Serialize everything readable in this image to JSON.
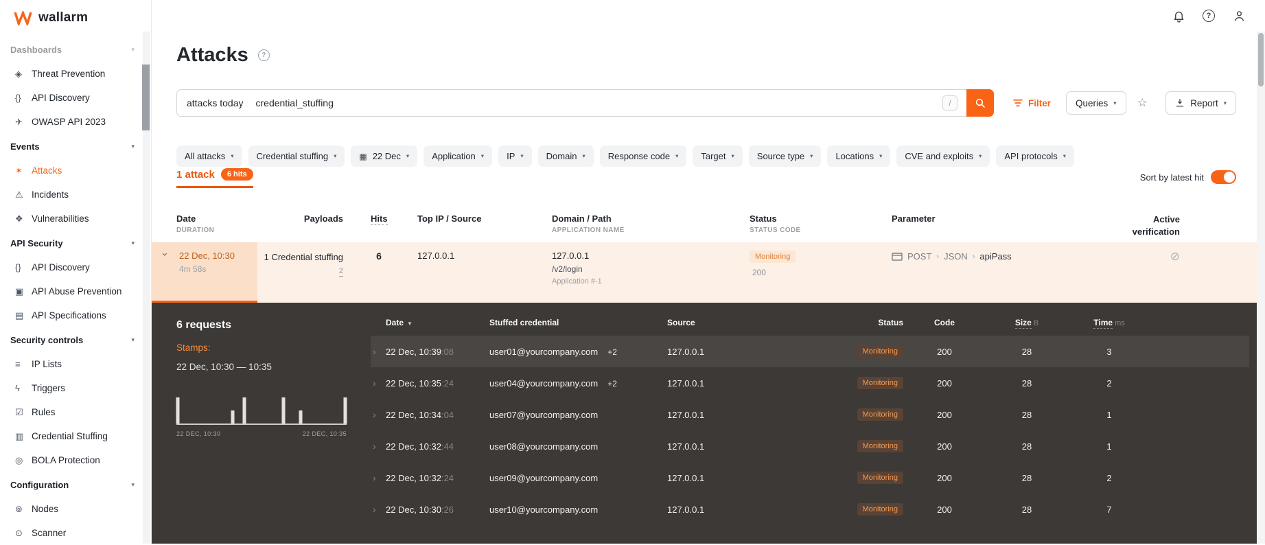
{
  "brand": {
    "name": "wallarm"
  },
  "topbar": {
    "icons": [
      "notifications-bell-icon",
      "help-icon",
      "user-icon"
    ]
  },
  "sidebar": {
    "items": [
      {
        "header": true,
        "label": "Dashboards",
        "faded": true
      },
      {
        "label": "Threat Prevention",
        "icon": "shield-check-icon"
      },
      {
        "label": "API Discovery",
        "icon": "code-braces-icon"
      },
      {
        "label": "OWASP API 2023",
        "icon": "paper-plane-icon"
      },
      {
        "header": true,
        "label": "Events"
      },
      {
        "label": "Attacks",
        "icon": "attack-burst-icon",
        "active": true
      },
      {
        "label": "Incidents",
        "icon": "warning-triangle-icon"
      },
      {
        "label": "Vulnerabilities",
        "icon": "vulnerability-icon"
      },
      {
        "header": true,
        "label": "API Security"
      },
      {
        "label": "API Discovery",
        "icon": "code-braces-icon"
      },
      {
        "label": "API Abuse Prevention",
        "icon": "bot-icon"
      },
      {
        "label": "API Specifications",
        "icon": "document-icon"
      },
      {
        "header": true,
        "label": "Security controls"
      },
      {
        "label": "IP Lists",
        "icon": "list-icon"
      },
      {
        "label": "Triggers",
        "icon": "lightning-icon"
      },
      {
        "label": "Rules",
        "icon": "checklist-icon"
      },
      {
        "label": "Credential Stuffing",
        "icon": "id-card-icon"
      },
      {
        "label": "BOLA Protection",
        "icon": "target-icon"
      },
      {
        "header": true,
        "label": "Configuration"
      },
      {
        "label": "Nodes",
        "icon": "nodes-icon"
      },
      {
        "label": "Scanner",
        "icon": "scanner-icon"
      }
    ]
  },
  "page": {
    "title": "Attacks"
  },
  "search": {
    "token1": "attacks today",
    "token2": "credential_stuffing",
    "shortcut": "/"
  },
  "toolbar": {
    "filter": "Filter",
    "queries": "Queries",
    "report": "Report"
  },
  "filter_chips": [
    {
      "label": "All attacks"
    },
    {
      "label": "Credential stuffing"
    },
    {
      "label": "22 Dec",
      "icon": "calendar-icon"
    },
    {
      "label": "Application"
    },
    {
      "label": "IP"
    },
    {
      "label": "Domain"
    },
    {
      "label": "Response code"
    },
    {
      "label": "Target"
    },
    {
      "label": "Source type"
    },
    {
      "label": "Locations"
    },
    {
      "label": "CVE and exploits"
    },
    {
      "label": "API protocols"
    }
  ],
  "results": {
    "count": "1 attack",
    "hits": "6 hits",
    "sort_label": "Sort by latest hit",
    "sort_enabled": true
  },
  "attacks_table": {
    "headers": {
      "date": "Date",
      "date_sub": "DURATION",
      "payloads": "Payloads",
      "hits": "Hits",
      "source": "Top IP / Source",
      "domain": "Domain / Path",
      "domain_sub": "APPLICATION NAME",
      "status": "Status",
      "status_sub": "STATUS CODE",
      "parameter": "Parameter",
      "verification": "Active verification"
    },
    "row": {
      "date": "22 Dec, 10:30",
      "duration": "4m 58s",
      "payloads": "1 Credential stuffing",
      "payloads_count": "2",
      "hits": "6",
      "top_ip": "127.0.0.1",
      "domain": "127.0.0.1",
      "path": "/v2/login",
      "application": "Application #-1",
      "status": "Monitoring",
      "status_code": "200",
      "param_method": "POST",
      "param_type": "JSON",
      "param_name": "apiPass"
    }
  },
  "detail_panel": {
    "requests_count": "6 requests",
    "stamps_label": "Stamps:",
    "stamps_range": "22 Dec, 10:30 — 10:35",
    "chart_data": {
      "type": "bar",
      "start_label": "22 DEC, 10:30",
      "end_label": "22 DEC, 10:35",
      "bars": [
        {
          "pos": 0.01,
          "h": 1
        },
        {
          "pos": 0.33,
          "h": 0.5
        },
        {
          "pos": 0.4,
          "h": 1
        },
        {
          "pos": 0.63,
          "h": 1
        },
        {
          "pos": 0.73,
          "h": 0.5
        },
        {
          "pos": 0.99,
          "h": 1
        }
      ]
    },
    "headers": {
      "date": "Date",
      "credential": "Stuffed credential",
      "source": "Source",
      "status": "Status",
      "code": "Code",
      "size": "Size",
      "size_unit": "B",
      "time": "Time",
      "time_unit": "ms"
    },
    "rows": [
      {
        "time": "22 Dec, 10:39",
        "seconds": ":08",
        "credential": "user01@yourcompany.com",
        "extra": "+2",
        "source": "127.0.0.1",
        "status": "Monitoring",
        "code": "200",
        "size": "28",
        "duration": "3",
        "highlight": true
      },
      {
        "time": "22 Dec, 10:35",
        "seconds": ":24",
        "credential": "user04@yourcompany.com",
        "extra": "+2",
        "source": "127.0.0.1",
        "status": "Monitoring",
        "code": "200",
        "size": "28",
        "duration": "2"
      },
      {
        "time": "22 Dec, 10:34",
        "seconds": ":04",
        "credential": "user07@yourcompany.com",
        "source": "127.0.0.1",
        "status": "Monitoring",
        "code": "200",
        "size": "28",
        "duration": "1"
      },
      {
        "time": "22 Dec, 10:32",
        "seconds": ":44",
        "credential": "user08@yourcompany.com",
        "source": "127.0.0.1",
        "status": "Monitoring",
        "code": "200",
        "size": "28",
        "duration": "1"
      },
      {
        "time": "22 Dec, 10:32",
        "seconds": ":24",
        "credential": "user09@yourcompany.com",
        "source": "127.0.0.1",
        "status": "Monitoring",
        "code": "200",
        "size": "28",
        "duration": "2"
      },
      {
        "time": "22 Dec, 10:30",
        "seconds": ":26",
        "credential": "user10@yourcompany.com",
        "source": "127.0.0.1",
        "status": "Monitoring",
        "code": "200",
        "size": "28",
        "duration": "7"
      }
    ]
  },
  "colors": {
    "accent": "#f96316",
    "accent_dark": "#ea580c",
    "panel_bg": "#3c3937",
    "monitoring_text": "#df8136"
  }
}
